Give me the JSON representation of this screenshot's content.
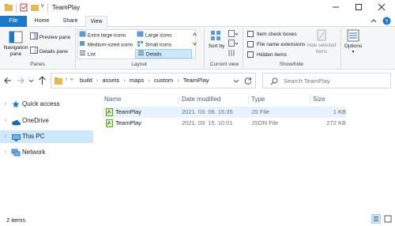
{
  "window": {
    "title": "TeamPlay"
  },
  "ribbon_tabs": [
    "File",
    "Home",
    "Share",
    "View"
  ],
  "ribbon": {
    "panes": {
      "navigation_pane": "Navigation pane",
      "preview_pane": "Preview pane",
      "details_pane": "Details pane",
      "group": "Panes"
    },
    "layout": {
      "extra_large": "Extra large icons",
      "large": "Large icons",
      "medium": "Medium-sized icons",
      "small": "Small icons",
      "list": "List",
      "details": "Details",
      "group": "Layout"
    },
    "current_view": {
      "sort_by": "Sort by",
      "group": "Current view"
    },
    "show_hide": {
      "item_check_boxes": "Item check boxes",
      "file_name_extensions": "File name extensions",
      "hidden_items": "Hidden items",
      "hide_selected": "Hide selected items",
      "group": "Show/hide"
    },
    "options": "Options"
  },
  "address": {
    "crumbs": [
      "build",
      "assets",
      "maps",
      "custom",
      "TeamPlay"
    ],
    "search_placeholder": "Search TeamPlay"
  },
  "nav": {
    "quick_access": "Quick access",
    "onedrive": "OneDrive",
    "this_pc": "This PC",
    "network": "Network"
  },
  "columns": {
    "name": "Name",
    "date": "Date modified",
    "type": "Type",
    "size": "Size"
  },
  "files": [
    {
      "name": "TeamPlay",
      "date": "2021. 03. 06. 15:35",
      "type": "JS File",
      "size": "1 KB"
    },
    {
      "name": "TeamPlay",
      "date": "2021. 03. 15. 10:01",
      "type": "JSON File",
      "size": "272 KB"
    }
  ],
  "status": {
    "count": "2 items"
  },
  "colors": {
    "accent": "#1979ca",
    "selected": "#cce8ff",
    "hover": "#e5f3ff"
  }
}
